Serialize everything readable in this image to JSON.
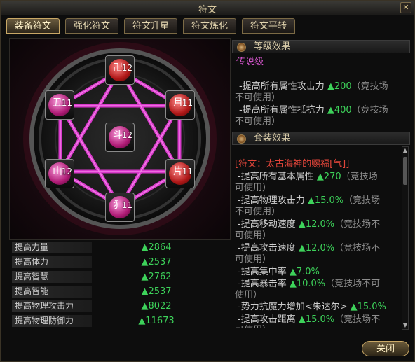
{
  "window": {
    "title": "符文"
  },
  "tabs": [
    {
      "label": "装备符文",
      "active": true
    },
    {
      "label": "强化符文",
      "active": false
    },
    {
      "label": "符文升星",
      "active": false
    },
    {
      "label": "符文炼化",
      "active": false
    },
    {
      "label": "符文平转",
      "active": false
    }
  ],
  "runes": [
    {
      "count": "12",
      "color": "red"
    },
    {
      "count": "11",
      "color": "pink"
    },
    {
      "count": "11",
      "color": "red"
    },
    {
      "count": "12",
      "color": "pink"
    },
    {
      "count": "12",
      "color": "pink"
    },
    {
      "count": "11",
      "color": "red"
    },
    {
      "count": "11",
      "color": "pink"
    }
  ],
  "stats": [
    {
      "label": "提高力量",
      "value": "▲2864"
    },
    {
      "label": "提高体力",
      "value": "▲2537"
    },
    {
      "label": "提高智慧",
      "value": "▲2762"
    },
    {
      "label": "提高智能",
      "value": "▲2537"
    },
    {
      "label": "提高物理攻击力",
      "value": "▲8022"
    },
    {
      "label": "提高物理防御力",
      "value": "▲11673"
    }
  ],
  "level_effect": {
    "header": "等级效果",
    "tier": "传说级",
    "lines": [
      {
        "pre": "-提高所有属性攻击力 ",
        "val": "▲200",
        "post": "（竞技场",
        "cont": "不可使用）"
      },
      {
        "pre": "-提高所有属性抵抗力 ",
        "val": "▲400",
        "post": "（竞技场",
        "cont": "不可使用）"
      }
    ]
  },
  "set_effect": {
    "header": "套装效果",
    "set_name": "[符文：太古海神的赐福[气]]",
    "lines": [
      {
        "pre": "-提高所有基本属性 ",
        "val": "▲270",
        "post": "（竞技场",
        "cont": "可使用）"
      },
      {
        "pre": "-提高物理攻击力 ",
        "val": "▲15.0%",
        "post": "（竞技场",
        "cont": "不可使用）"
      },
      {
        "pre": "-提高移动速度 ",
        "val": "▲12.0%",
        "post": "（竞技场不",
        "cont": "可使用）"
      },
      {
        "pre": "-提高攻击速度 ",
        "val": "▲12.0%",
        "post": "（竞技场不",
        "cont": "可使用）"
      },
      {
        "pre": "-提高集中率 ",
        "val": "▲7.0%",
        "post": "",
        "cont": ""
      },
      {
        "pre": "-提高暴击率 ",
        "val": "▲10.0%",
        "post": "（竞技场不可",
        "cont": "使用）"
      },
      {
        "pre": "-势力抗魔力增加<朱达尔> ",
        "val": "▲15.0%",
        "post": "",
        "cont": ""
      },
      {
        "pre": "-提高攻击距离 ",
        "val": "▲15.0%",
        "post": "（竞技场不",
        "cont": "可使用）"
      }
    ]
  },
  "footer": {
    "close_label": "关闭"
  }
}
